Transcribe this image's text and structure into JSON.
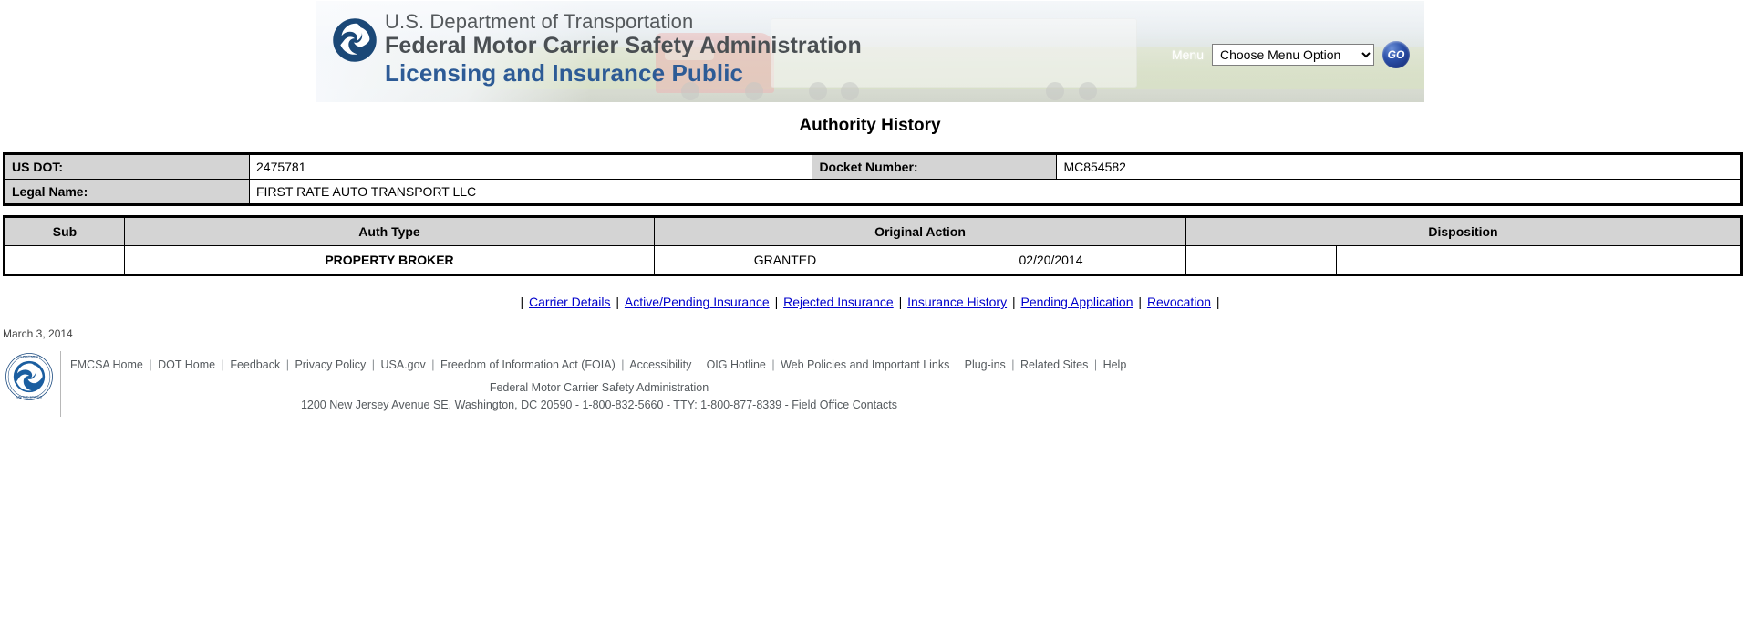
{
  "banner": {
    "agency_line1": "U.S. Department of Transportation",
    "agency_line2": "Federal Motor Carrier Safety Administration",
    "app_title": "Licensing and Insurance Public",
    "menu_label": "Menu",
    "menu_selected": "Choose Menu Option",
    "menu_options": [
      "Choose Menu Option"
    ],
    "go_label": "GO",
    "logo_name": "dot-triskelion-logo",
    "brand_blue": "#2d5b96",
    "go_blue": "#15276e"
  },
  "page": {
    "title": "Authority History"
  },
  "info": {
    "rows": [
      {
        "label1": "US DOT:",
        "value1": "2475781",
        "label2": "Docket Number:",
        "value2": "MC854582"
      },
      {
        "label1": "Legal Name:",
        "value1": "FIRST RATE AUTO TRANSPORT LLC"
      }
    ]
  },
  "history": {
    "headers": [
      "Sub",
      "Auth Type",
      "Original Action",
      "Disposition"
    ],
    "rows": [
      {
        "sub": "",
        "auth_type": "PROPERTY BROKER",
        "original_action": "GRANTED",
        "original_action_date": "02/20/2014",
        "disposition": "",
        "disposition_date": ""
      }
    ]
  },
  "nav": {
    "links": [
      "Carrier Details",
      "Active/Pending Insurance",
      "Rejected Insurance",
      "Insurance History",
      "Pending Application",
      "Revocation"
    ],
    "separator": "|"
  },
  "print_date": "March 3, 2014",
  "footer": {
    "links": [
      "FMCSA Home",
      "DOT Home",
      "Feedback",
      "Privacy Policy",
      "USA.gov",
      "Freedom of Information Act (FOIA)",
      "Accessibility",
      "OIG Hotline",
      "Web Policies and Important Links",
      "Plug-ins",
      "Related Sites",
      "Help"
    ],
    "separator": "|",
    "agency": "Federal Motor Carrier Safety Administration",
    "address": "1200 New Jersey Avenue SE, Washington, DC 20590 - 1-800-832-5660 - TTY: 1-800-877-8339 - Field Office Contacts",
    "seal_name": "dot-seal"
  }
}
